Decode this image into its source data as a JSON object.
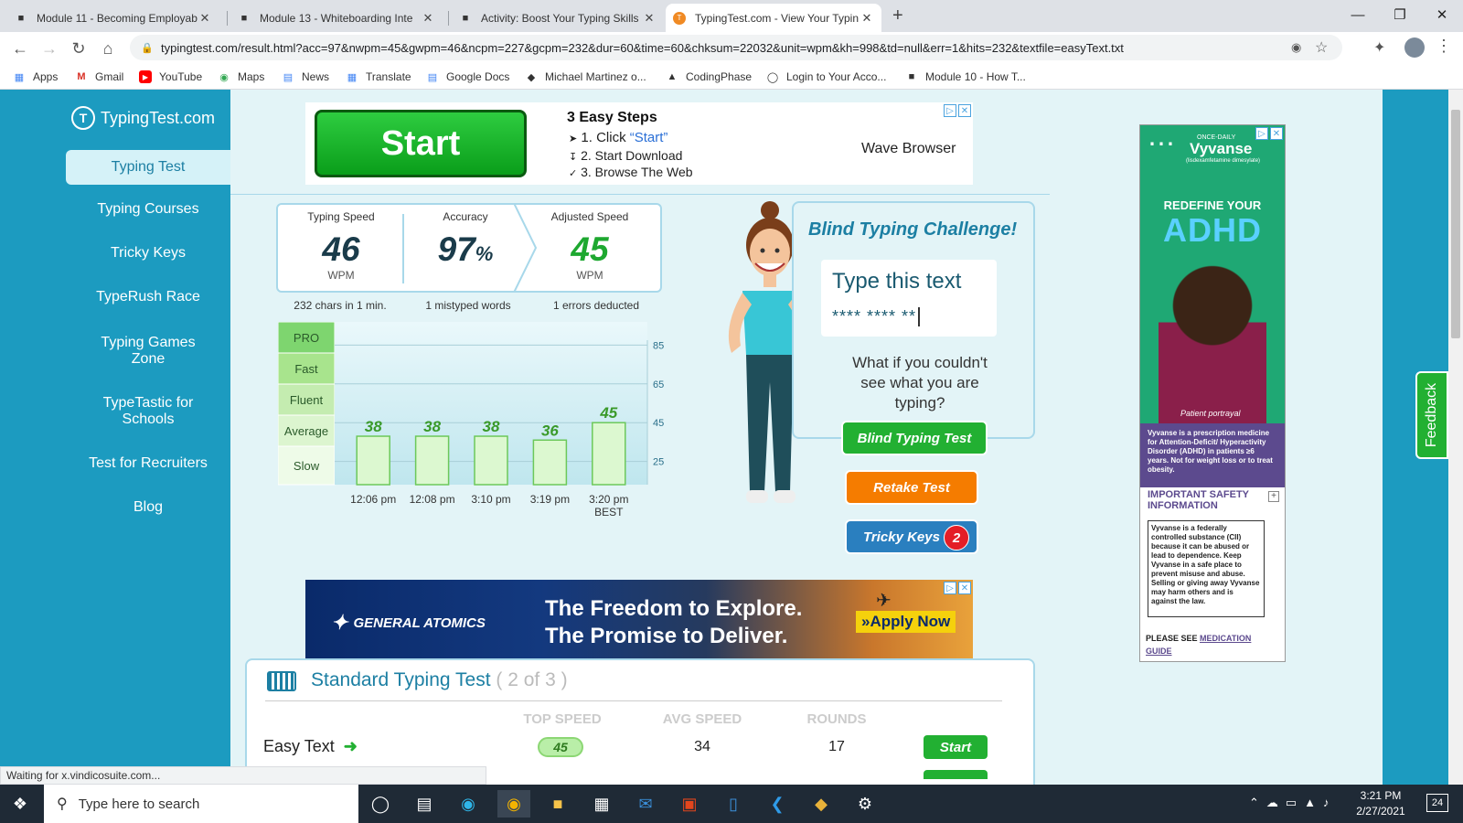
{
  "browser": {
    "tabs": [
      {
        "title": "Module 11 - Becoming Employab",
        "icon": "book-icon"
      },
      {
        "title": "Module 13 - Whiteboarding Inte",
        "icon": "book-icon"
      },
      {
        "title": "Activity: Boost Your Typing Skills",
        "icon": "book-icon"
      },
      {
        "title": "TypingTest.com - View Your Typin",
        "icon": "typingtest-icon"
      }
    ],
    "new_tab": "+",
    "url": "typingtest.com/result.html?acc=97&nwpm=45&gwpm=46&ncpm=227&gcpm=232&dur=60&time=60&chksum=22032&unit=wpm&kh=998&td=null&err=1&hits=232&textfile=easyText.txt",
    "bookmarks": [
      "Apps",
      "Gmail",
      "YouTube",
      "Maps",
      "News",
      "Translate",
      "Google Docs",
      "Michael Martinez o...",
      "CodingPhase",
      "Login to Your Acco...",
      "Module 10 - How T..."
    ],
    "status": "Waiting for x.vindicosuite.com..."
  },
  "sidebar": {
    "logo": "TypingTest.com",
    "items": [
      "Typing Test",
      "Typing Courses",
      "Tricky Keys",
      "TypeRush Race",
      "Typing Games Zone",
      "TypeTastic for Schools",
      "Test for Recruiters",
      "Blog"
    ]
  },
  "top_ad": {
    "start_label": "Start",
    "title": "3 Easy Steps",
    "step1_prefix": "1. Click ",
    "step1_link": "“Start”",
    "step2": "2. Start Download",
    "step3": "3. Browse The Web",
    "brand": "Wave Browser"
  },
  "results": {
    "speed_label": "Typing Speed",
    "speed_value": "46",
    "speed_unit": "WPM",
    "acc_label": "Accuracy",
    "acc_value": "97",
    "acc_unit": "%",
    "adj_label": "Adjusted Speed",
    "adj_value": "45",
    "adj_unit": "WPM",
    "speed_sub": "232 chars in 1 min.",
    "acc_sub": "1 mistyped words",
    "adj_sub": "1 errors deducted"
  },
  "chart_data": {
    "type": "bar",
    "categories": [
      "12:06 pm",
      "12:08 pm",
      "3:10 pm",
      "3:19 pm",
      "3:20 pm"
    ],
    "best_label": "BEST",
    "values": [
      38,
      38,
      38,
      36,
      45
    ],
    "ylim": [
      13,
      97
    ],
    "y_ticks": [
      85,
      65,
      45,
      25
    ],
    "levels": [
      "PRO",
      "Fast",
      "Fluent",
      "Average",
      "Slow"
    ],
    "colors": {
      "bar": "#dcf8d0",
      "bar_border": "#6cc85a",
      "value_text": "#3a9a2a"
    }
  },
  "blind": {
    "title": "Blind Typing Challenge!",
    "input_label": "Type this text",
    "masked": "**** **** **",
    "question": "What if you couldn't see what you are typing?",
    "blind_btn": "Blind Typing Test",
    "retake_btn": "Retake Test",
    "tricky_btn": "Tricky Keys",
    "tricky_count": "2"
  },
  "bottom_ad": {
    "brand": "GENERAL ATOMICS",
    "line1": "The Freedom to Explore.",
    "line2": "The Promise to Deliver.",
    "cta": "»Apply Now"
  },
  "side_ad": {
    "brand": "Vyvanse",
    "once_daily": "ONCE-DAILY",
    "drug": "(lisdexamfetamine dimesylate)",
    "headline1": "REDEFINE YOUR",
    "headline2": "ADHD",
    "portrayal": "Patient portrayal",
    "desc": "Vyvanse is a prescription medicine for Attention-Deficit/ Hyperactivity Disorder (ADHD) in patients ≥6 years. Not for weight loss or to treat obesity.",
    "safety_title": "IMPORTANT SAFETY INFORMATION",
    "safety_text": "Vyvanse is a federally controlled substance (CII) because it can be abused or lead to dependence. Keep Vyvanse in a safe place to prevent misuse and abuse. Selling or giving away Vyvanse may harm others and is against the law.",
    "please_see": "PLEASE SEE ",
    "med_guide": "MEDICATION GUIDE"
  },
  "feedback": "Feedback",
  "standard": {
    "title": "Standard Typing Test",
    "count": "( 2 of 3 )",
    "col_top": "TOP SPEED",
    "col_avg": "AVG SPEED",
    "col_rounds": "ROUNDS",
    "row_name": "Easy Text",
    "row_top": "45",
    "row_avg": "34",
    "row_rounds": "17",
    "row_btn": "Start"
  },
  "taskbar": {
    "search_placeholder": "Type here to search",
    "time": "3:21 PM",
    "date": "2/27/2021",
    "notif": "24"
  }
}
